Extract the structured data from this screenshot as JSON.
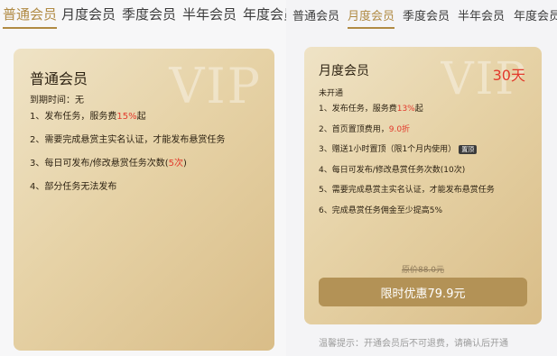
{
  "tabs_left": [
    {
      "label": "普通会员",
      "active": true
    },
    {
      "label": "月度会员",
      "active": false
    },
    {
      "label": "季度会员",
      "active": false
    },
    {
      "label": "半年会员",
      "active": false
    },
    {
      "label": "年度会员",
      "active": false
    }
  ],
  "tabs_right": [
    {
      "label": "普通会员",
      "active": false
    },
    {
      "label": "月度会员",
      "active": true
    },
    {
      "label": "季度会员",
      "active": false
    },
    {
      "label": "半年会员",
      "active": false
    },
    {
      "label": "年度会员",
      "active": false
    }
  ],
  "left_card": {
    "watermark": "VIP",
    "title": "普通会员",
    "expiry_label": "到期时间：",
    "expiry_value": "无",
    "benefits": [
      {
        "pre": "1、发布任务，服务费",
        "hl": "15%",
        "post": "起"
      },
      {
        "pre": "2、需要完成悬赏主实名认证，才能发布悬赏任务",
        "hl": "",
        "post": ""
      },
      {
        "pre": "3、每日可发布/修改悬赏任务次数(",
        "hl": "5次",
        "post": ")"
      },
      {
        "pre": "4、部分任务无法发布",
        "hl": "",
        "post": ""
      }
    ]
  },
  "right_card": {
    "watermark": "VIP",
    "title": "月度会员",
    "duration": "30天",
    "status": "未开通",
    "benefits": [
      {
        "pre": "1、发布任务，服务费",
        "hl": "13%",
        "post": "起",
        "badge": ""
      },
      {
        "pre": "2、首页置顶费用，",
        "hl": "9.0折",
        "post": "",
        "badge": ""
      },
      {
        "pre": "3、赠送1小时置顶（限1个月内使用）",
        "hl": "",
        "post": "",
        "badge": "置顶"
      },
      {
        "pre": "4、每日可发布/修改悬赏任务次数(10次)",
        "hl": "",
        "post": "",
        "badge": ""
      },
      {
        "pre": "5、需要完成悬赏主实名认证，才能发布悬赏任务",
        "hl": "",
        "post": "",
        "badge": ""
      },
      {
        "pre": "6、完成悬赏任务佣金至少提高5%",
        "hl": "",
        "post": "",
        "badge": ""
      }
    ],
    "original_price": "原价88.0元",
    "buy_button": "限时优惠79.9元"
  },
  "notice": "温馨提示：开通会员后不可退费，请确认后开通",
  "colors": {
    "accent": "#b08a43",
    "highlight": "#e23a2c",
    "button": "#b39256"
  }
}
